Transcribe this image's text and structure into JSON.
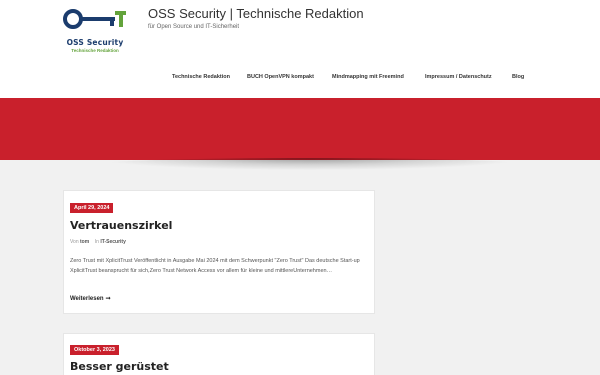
{
  "site": {
    "title": "OSS Security | Technische Redaktion",
    "description": "für Open Source und IT-Sicherheit",
    "logo_text": "OSS Security",
    "logo_sub": "Technische Redaktion"
  },
  "nav": {
    "items": [
      {
        "label": "Technische Redaktion"
      },
      {
        "label": "BUCH OpenVPN kompakt"
      },
      {
        "label": "Mindmapping mit Freemind"
      },
      {
        "label": "Impressum / Datenschutz"
      },
      {
        "label": "Blog"
      }
    ]
  },
  "colors": {
    "accent": "#c9202c",
    "logo_blue": "#1b3c6d",
    "logo_green": "#63a33b"
  },
  "posts": [
    {
      "date": "April 29, 2024",
      "title": "Vertrauenszirkel",
      "by_label": "Von",
      "author": "tom",
      "in_label": "In",
      "category": "IT-Security",
      "excerpt": "Zero Trust mit XplicitTrust Veröffentlicht in Ausgabe Mai 2024 mit dem Schwerpunkt \"Zero Trust\" Das deutsche Start-up XplicitTrust beansprucht für sich,Zero Trust Network Access vor allem für kleine und mittlereUnternehmen…",
      "read_more": "Weiterlesen",
      "arrow_icon": "arrow-right-icon"
    },
    {
      "date": "Oktober 3, 2023",
      "title": "Besser gerüstet"
    }
  ]
}
